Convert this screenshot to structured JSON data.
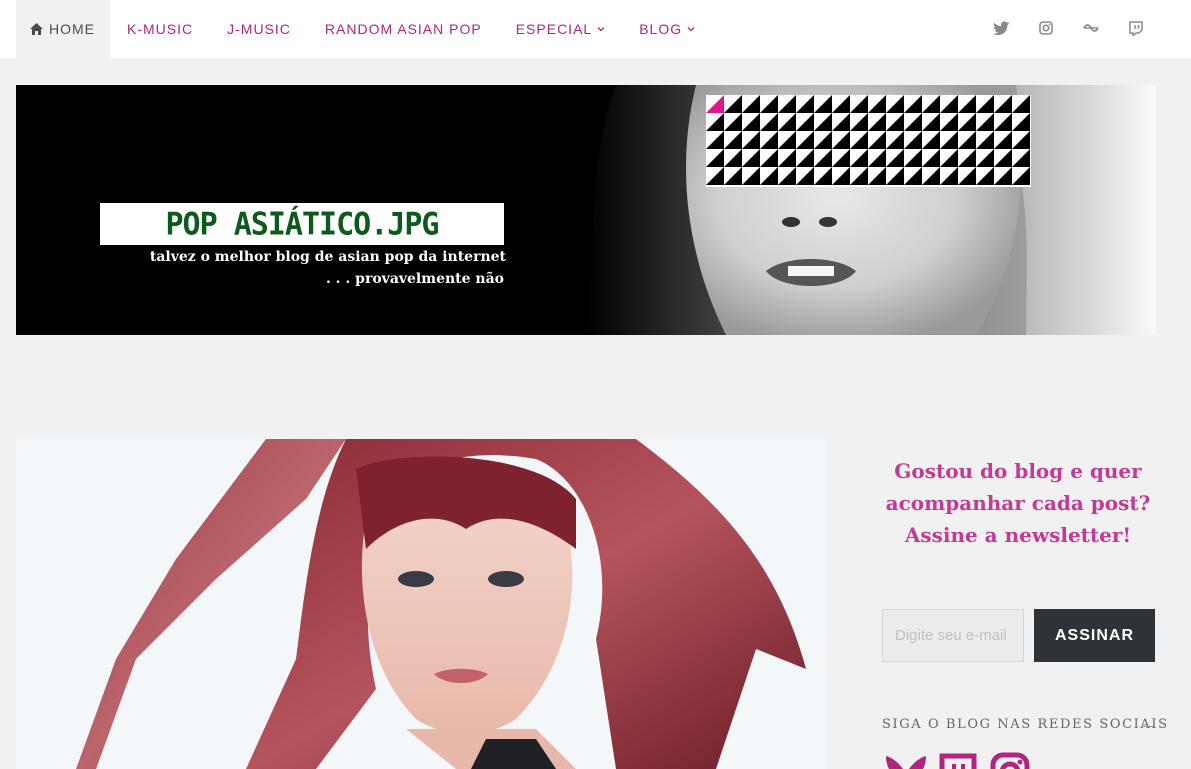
{
  "nav": {
    "items": [
      {
        "label": "HOME",
        "active": true
      },
      {
        "label": "K-MUSIC"
      },
      {
        "label": "J-MUSIC"
      },
      {
        "label": "RANDOM ASIAN POP"
      },
      {
        "label": "ESPECIAL",
        "dropdown": true
      },
      {
        "label": "BLOG",
        "dropdown": true
      }
    ],
    "social_icons": [
      "twitter-icon",
      "instagram-icon",
      "lastfm-icon",
      "twitch-icon"
    ]
  },
  "banner": {
    "logo_text": "POP ASIÁTICO.JPG",
    "tagline_line1": "talvez o melhor blog de asian pop da internet",
    "tagline_line2": ". . . provavelmente não"
  },
  "sidebar": {
    "newsletter_title": "Gostou do blog e quer acompanhar cada post? Assine a newsletter!",
    "email_placeholder": "Digite seu e-mail",
    "subscribe_label": "ASSINAR",
    "follow_title": "SIGA O BLOG NAS REDES SOCIAIS",
    "social_icons": [
      "bluesky-icon",
      "twitch-icon",
      "instagram-icon"
    ]
  },
  "colors": {
    "accent": "#b0257f",
    "heading": "#c23a94",
    "button": "#2e3338",
    "page_bg": "#f1f1f1"
  }
}
